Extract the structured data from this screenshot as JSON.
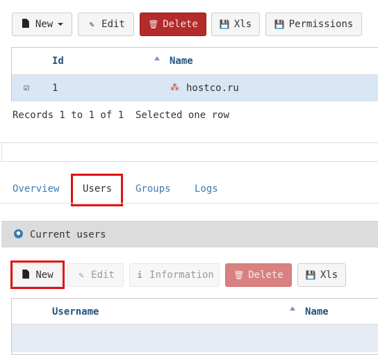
{
  "toolbar": {
    "new_label": "New",
    "edit_label": "Edit",
    "delete_label": "Delete",
    "xls_label": "Xls",
    "permissions_label": "Permissions"
  },
  "grid": {
    "columns": [
      "Id",
      "Name"
    ],
    "rows": [
      {
        "id": "1",
        "name": "hostco.ru"
      }
    ]
  },
  "status": {
    "records_text": "Records 1 to 1 of 1",
    "selection_text": "Selected one row"
  },
  "tabs": [
    {
      "label": "Overview"
    },
    {
      "label": "Users"
    },
    {
      "label": "Groups"
    },
    {
      "label": "Logs"
    }
  ],
  "panel": {
    "title": "Current users"
  },
  "users_toolbar": {
    "new_label": "New",
    "edit_label": "Edit",
    "information_label": "Information",
    "delete_label": "Delete",
    "xls_label": "Xls"
  },
  "users_grid": {
    "columns": [
      "Username",
      "Name"
    ]
  },
  "colors": {
    "delete_active": "#b52a2a",
    "delete_disabled": "#d98080",
    "highlight": "#e01010",
    "link": "#3a7bb0",
    "row_selected": "#d9e6f3"
  }
}
